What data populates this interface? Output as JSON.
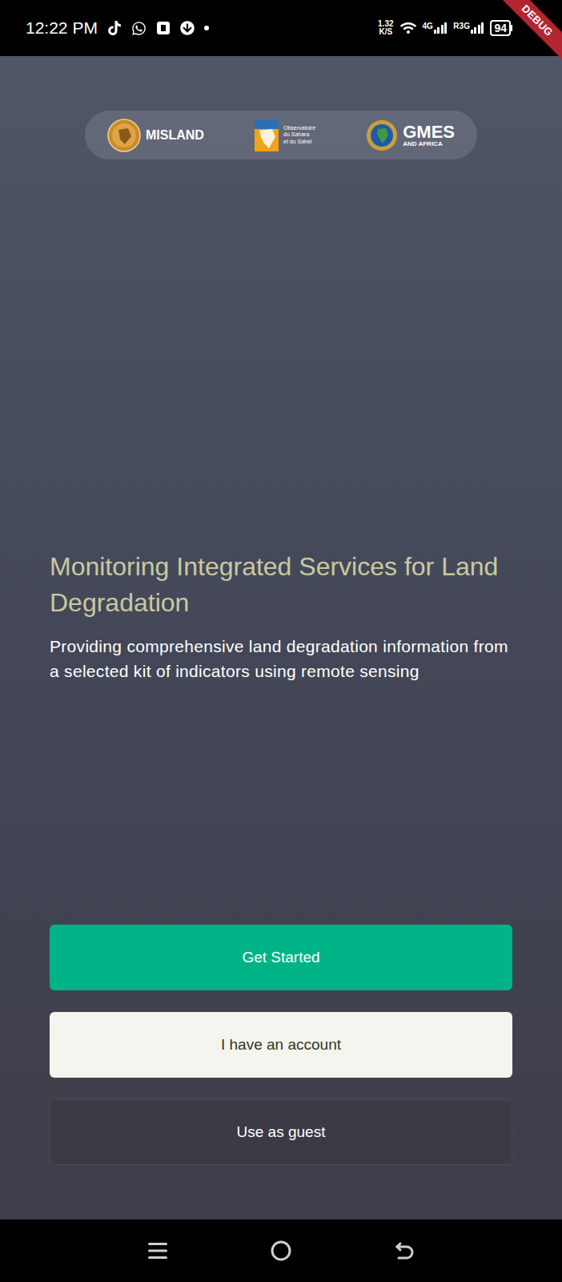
{
  "status_bar": {
    "time": "12:22 PM",
    "speed": "1.32",
    "speed_unit": "K/S",
    "network_1": "4G",
    "network_2": "R3G",
    "battery": "94"
  },
  "debug_banner": "DEBUG",
  "partners": [
    {
      "name": "MISLAND",
      "lines": []
    },
    {
      "name": "",
      "lines": [
        "Observatoire",
        "du Sahara",
        "et du Sahel"
      ]
    },
    {
      "name": "GMES",
      "lines": [
        "AND AFRICA"
      ]
    }
  ],
  "headline": "Monitoring Integrated Services for Land Degradation",
  "description": "Providing comprehensive land degradation information from a selected kit of indicators using remote sensing",
  "buttons": [
    {
      "label": "Get Started",
      "kind": "primary"
    },
    {
      "label": "I have an account",
      "kind": "secondary"
    },
    {
      "label": "Use as guest",
      "kind": "ghost"
    }
  ]
}
